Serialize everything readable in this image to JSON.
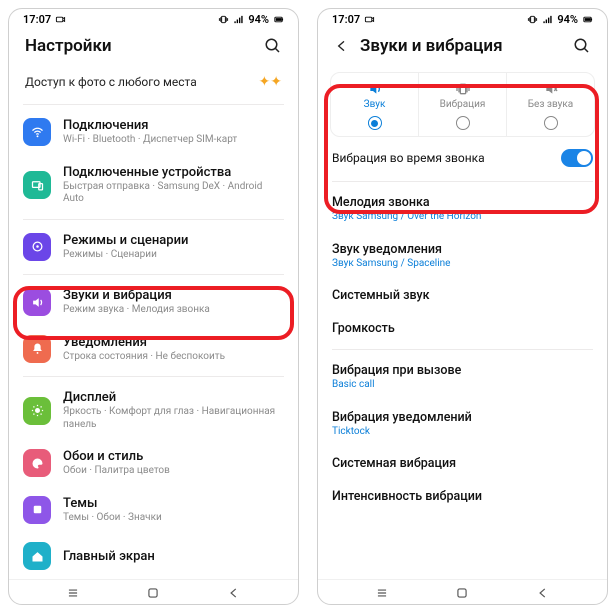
{
  "status": {
    "time": "17:07",
    "battery": "94%"
  },
  "left": {
    "title": "Настройки",
    "promo": "Доступ к фото с любого места",
    "items": [
      {
        "title": "Подключения",
        "sub": "Wi-Fi · Bluetooth · Диспетчер SIM-карт"
      },
      {
        "title": "Подключенные устройства",
        "sub": "Быстрая отправка · Samsung DeX · Android Auto"
      },
      {
        "title": "Режимы и сценарии",
        "sub": "Режимы · Сценарии"
      },
      {
        "title": "Звуки и вибрация",
        "sub": "Режим звука · Мелодия звонка"
      },
      {
        "title": "Уведомления",
        "sub": "Строка состояния · Не беспокоить"
      },
      {
        "title": "Дисплей",
        "sub": "Яркость · Комфорт для глаз · Навигационная панель"
      },
      {
        "title": "Обои и стиль",
        "sub": "Обои · Палитра цветов"
      },
      {
        "title": "Темы",
        "sub": "Темы · Обои · Значки"
      },
      {
        "title": "Главный экран"
      }
    ]
  },
  "right": {
    "title": "Звуки и вибрация",
    "modes": {
      "sound": "Звук",
      "vibration": "Вибрация",
      "mute": "Без звука"
    },
    "vibrate_calling": "Вибрация во время звонка",
    "items": [
      {
        "title": "Мелодия звонка",
        "sub": "Звук Samsung / Over the Horizon"
      },
      {
        "title": "Звук уведомления",
        "sub": "Звук Samsung / Spaceline"
      },
      {
        "title": "Системный звук"
      },
      {
        "title": "Громкость"
      },
      {
        "title": "Вибрация при вызове",
        "sub": "Basic call"
      },
      {
        "title": "Вибрация уведомлений",
        "sub": "Ticktock"
      },
      {
        "title": "Системная вибрация"
      },
      {
        "title": "Интенсивность вибрации"
      }
    ]
  },
  "colors": {
    "accent": "#0a7ed8",
    "highlight": "#ec1d24"
  }
}
